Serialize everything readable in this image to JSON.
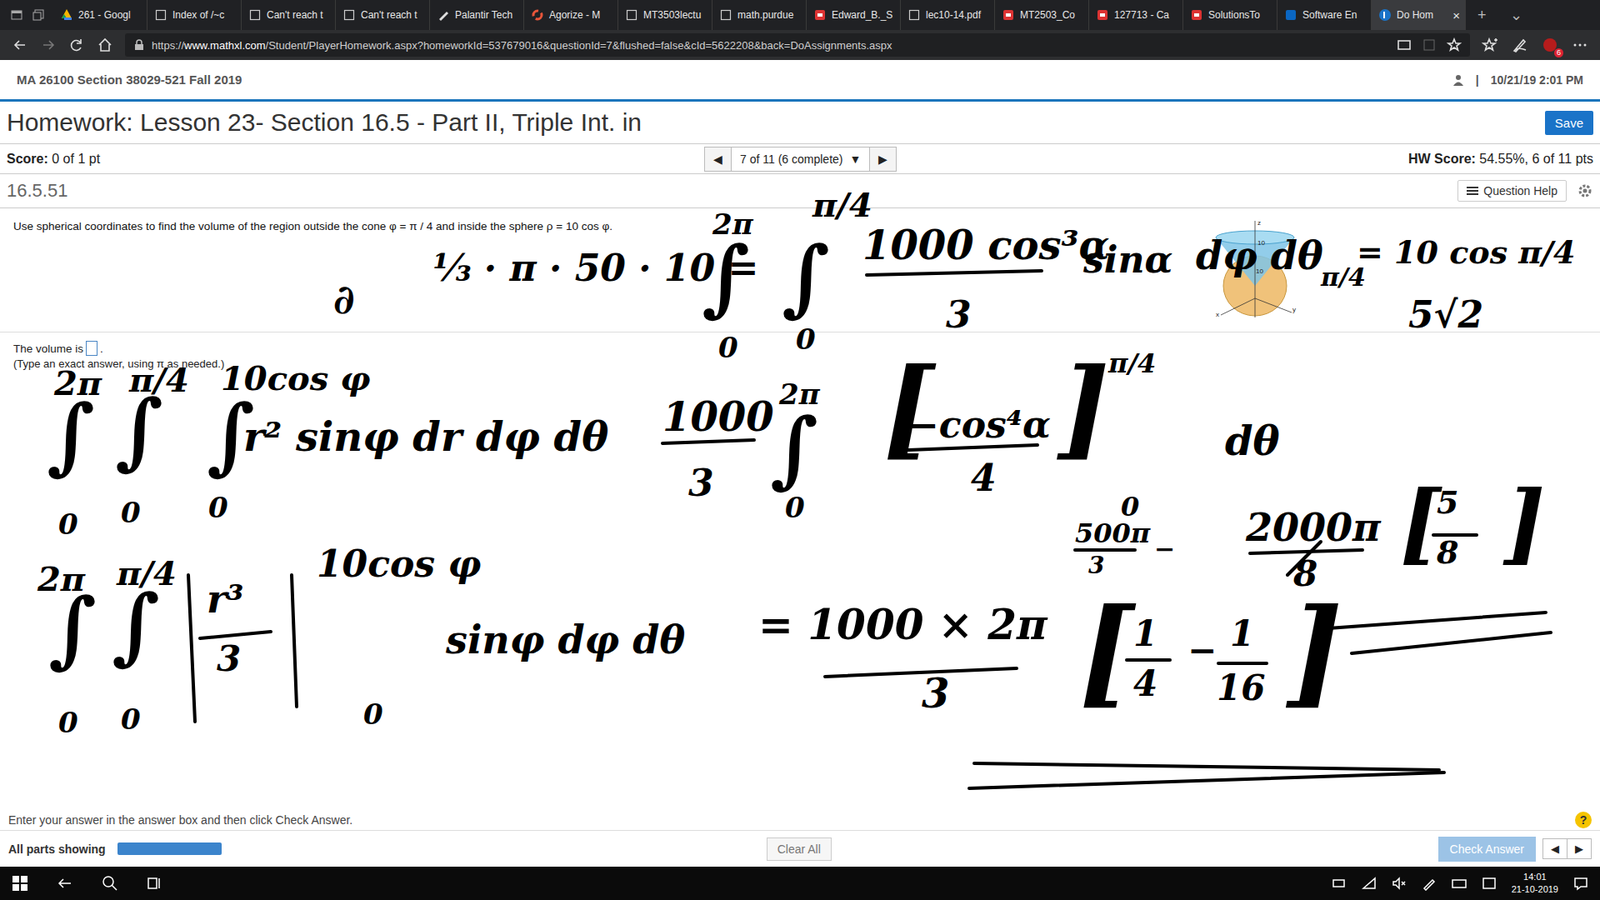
{
  "browser": {
    "tabs": [
      {
        "label": "261 - Googl",
        "selected": false,
        "kind": "drive"
      },
      {
        "label": "Index of /~c",
        "selected": false,
        "kind": "page"
      },
      {
        "label": "Can't reach t",
        "selected": false,
        "kind": "page"
      },
      {
        "label": "Can't reach t",
        "selected": false,
        "kind": "page"
      },
      {
        "label": "Palantir Tech",
        "selected": false,
        "kind": "pen"
      },
      {
        "label": "Agorize - M",
        "selected": false,
        "kind": "ring"
      },
      {
        "label": "MT3503lectu",
        "selected": false,
        "kind": "page"
      },
      {
        "label": "math.purdue",
        "selected": false,
        "kind": "page"
      },
      {
        "label": "Edward_B._S",
        "selected": false,
        "kind": "pdf"
      },
      {
        "label": "lec10-14.pdf",
        "selected": false,
        "kind": "page"
      },
      {
        "label": "MT2503_Co",
        "selected": false,
        "kind": "pdf"
      },
      {
        "label": "127713 - Ca",
        "selected": false,
        "kind": "pdf"
      },
      {
        "label": "SolutionsTo",
        "selected": false,
        "kind": "pdf"
      },
      {
        "label": "Software En",
        "selected": false,
        "kind": "linkedin"
      },
      {
        "label": "Do Hom",
        "selected": true,
        "kind": "p"
      }
    ],
    "close": "×",
    "new_tab": "+",
    "tab_menu": "⌄",
    "url_scheme": "https://",
    "url_host": "www.mathxl.com",
    "url_path": "/Student/PlayerHomework.aspx?homeworkId=537679016&questionId=7&flushed=false&cId=5622208&back=DoAssignments.aspx",
    "extension_badge": "6"
  },
  "page": {
    "course": "MA 26100 Section 38029-521 Fall 2019",
    "separator": "|",
    "datetime": "10/21/19 2:01 PM",
    "title": "Homework: Lesson 23- Section 16.5 - Part II, Triple Int. in",
    "save": "Save",
    "score_label": "Score:",
    "score": "0 of 1 pt",
    "nav": {
      "prev": "◀",
      "position": "7 of 11 (6 complete)",
      "dropdown": "▼",
      "next": "▶"
    },
    "hw_score_label": "HW Score:",
    "hw_score": "54.55%, 6 of 11 pts",
    "question_id": "16.5.51",
    "question_help": "Question Help",
    "question": "Use spherical coordinates to find the volume of the region outside the cone φ = π / 4 and inside the sphere ρ = 10 cos φ.",
    "figure_labels": [
      "z",
      "10",
      "10",
      "x",
      "y"
    ],
    "answer_prefix": "The volume is",
    "answer_suffix": ".",
    "answer_hint": "(Type an exact answer, using π as needed.)",
    "instructions": "Enter your answer in the answer box and then click Check Answer.",
    "help": "?",
    "parts_label": "All parts showing",
    "parts_level": 1,
    "clear_all": "Clear All",
    "check_answer": "Check Answer",
    "check_disabled": true,
    "prev": "◀",
    "next": "▶"
  },
  "ink": [
    {
      "text": "∂"
    },
    {
      "text": "⅓ · π · 50 · 10 ="
    },
    {
      "text": "2π"
    },
    {
      "text": "∫"
    },
    {
      "text": "0"
    },
    {
      "text": "π/4"
    },
    {
      "text": "∫"
    },
    {
      "text": "0"
    },
    {
      "text": "1000 cos³α"
    },
    {
      "text": "3"
    },
    {
      "text": "sinα"
    },
    {
      "text": "dφ dθ"
    },
    {
      "text": "π/4"
    },
    {
      "text": "= 10 cos π/4"
    },
    {
      "text": "5√2"
    },
    {
      "text": "2π"
    },
    {
      "text": "π/4"
    },
    {
      "text": "10cos φ"
    },
    {
      "text": "∫"
    },
    {
      "text": "∫"
    },
    {
      "text": "∫"
    },
    {
      "text": "r² sinφ dr  dφ dθ"
    },
    {
      "text": "0"
    },
    {
      "text": "0"
    },
    {
      "text": "0"
    },
    {
      "text": "1000"
    },
    {
      "text": "3"
    },
    {
      "text": "2π"
    },
    {
      "text": "∫"
    },
    {
      "text": "0"
    },
    {
      "text": "["
    },
    {
      "text": "−cos⁴α"
    },
    {
      "text": "4"
    },
    {
      "text": "]"
    },
    {
      "text": "π/4"
    },
    {
      "text": "0"
    },
    {
      "text": "dθ"
    },
    {
      "text": "2π"
    },
    {
      "text": "π/4"
    },
    {
      "text": "10cos φ"
    },
    {
      "text": "∫"
    },
    {
      "text": "∫"
    },
    {
      "text": "r³"
    },
    {
      "text": "3"
    },
    {
      "text": "0"
    },
    {
      "text": "0"
    },
    {
      "text": "0"
    },
    {
      "text": "sinφ  dφ dθ"
    },
    {
      "text": "= 1000 × 2π"
    },
    {
      "text": "3"
    },
    {
      "text": "["
    },
    {
      "text": "1"
    },
    {
      "text": "4"
    },
    {
      "text": "−"
    },
    {
      "text": "1"
    },
    {
      "text": "16"
    },
    {
      "text": "]"
    },
    {
      "text": "500π"
    },
    {
      "text": "3"
    },
    {
      "text": "−"
    },
    {
      "text": "2000π"
    },
    {
      "text": "8"
    },
    {
      "text": "["
    },
    {
      "text": "5"
    },
    {
      "text": "8"
    },
    {
      "text": "]"
    }
  ],
  "taskbar": {
    "time": "14:01",
    "date": "21-10-2019"
  }
}
